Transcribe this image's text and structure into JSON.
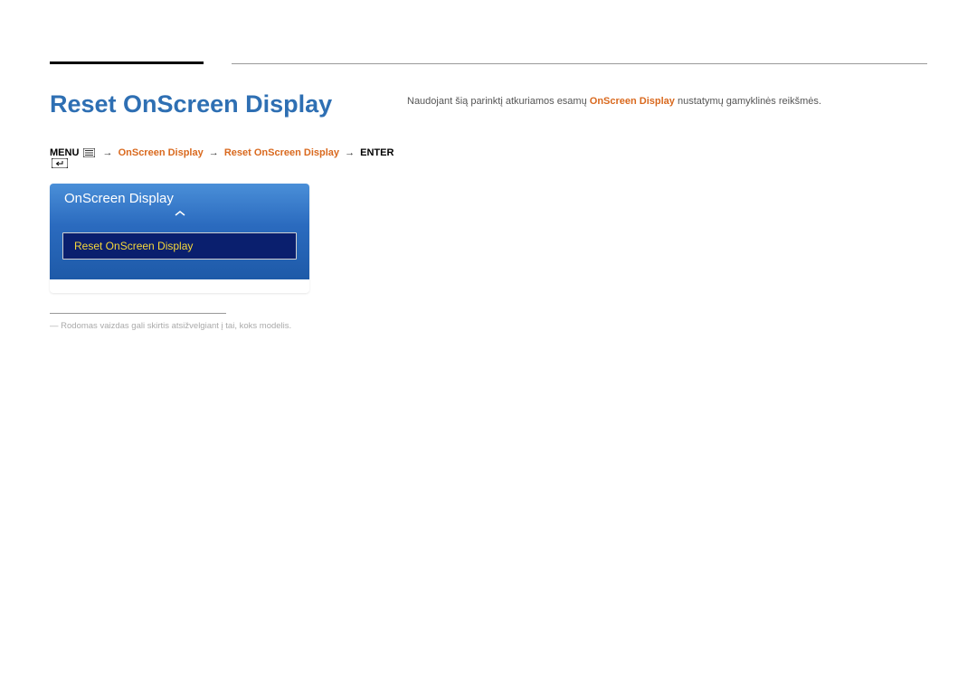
{
  "heading": "Reset OnScreen Display",
  "breadcrumb": {
    "menu_label": "MENU",
    "arrow": "→",
    "step1": "OnScreen Display",
    "step2": "Reset OnScreen Display",
    "enter_label": "ENTER"
  },
  "osd_panel": {
    "header_title": "OnScreen Display",
    "selected_item": "Reset OnScreen Display"
  },
  "description": {
    "prefix": "Naudojant šią parinktį atkuriamos esamų ",
    "highlight": "OnScreen Display",
    "suffix": " nustatymų gamyklinės reikšmės."
  },
  "footnote": {
    "dash": "―",
    "text": "Rodomas vaizdas gali skirtis atsižvelgiant į tai, koks modelis."
  }
}
